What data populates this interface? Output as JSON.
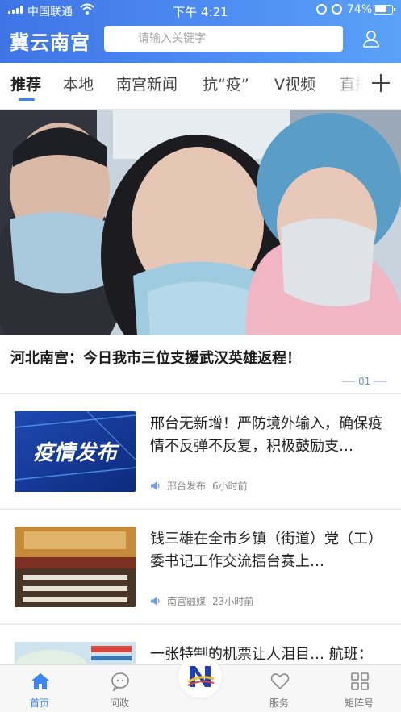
{
  "status_bar": {
    "carrier": "中国联通",
    "time": "下午 4:21",
    "battery": "74%",
    "battery_level": 0.74
  },
  "header": {
    "logo": "冀云南宫",
    "search_placeholder": "请输入关键字",
    "user_icon": "user-icon"
  },
  "tabs": [
    {
      "label": "推荐",
      "active": true
    },
    {
      "label": "本地"
    },
    {
      "label": "南宫新闻"
    },
    {
      "label": "抗“疫”"
    },
    {
      "label": "V视频"
    },
    {
      "label": "直播"
    }
  ],
  "hero": {
    "title": "河北南宫：今日我市三位支援武汉英雄返程！",
    "page": "01"
  },
  "news": [
    {
      "title": "邢台无新增！严防境外输入，确保疫情不反弹不反复，积极鼓励支…",
      "thumb_text": "疫情发布",
      "source": "邢台发布",
      "time": "6小时前"
    },
    {
      "title": "钱三雄在全市乡镇（街道）党（工）委书记工作交流擂台赛上…",
      "source": "南宫融媒",
      "time": "23小时前"
    },
    {
      "title": "一张特制的机票让人泪目… 航班："
    }
  ],
  "bottom_nav": [
    {
      "label": "首页",
      "icon": "home-icon",
      "active": true
    },
    {
      "label": "问政",
      "icon": "chat-bubble-icon"
    },
    {
      "label": "服务",
      "icon": "heart-icon"
    },
    {
      "label": "矩阵号",
      "icon": "grid-icon"
    }
  ],
  "colors": {
    "brand": "#4a86ef",
    "active_tab_indicator": "#3e86f0",
    "nav_active": "#3e86f0"
  }
}
